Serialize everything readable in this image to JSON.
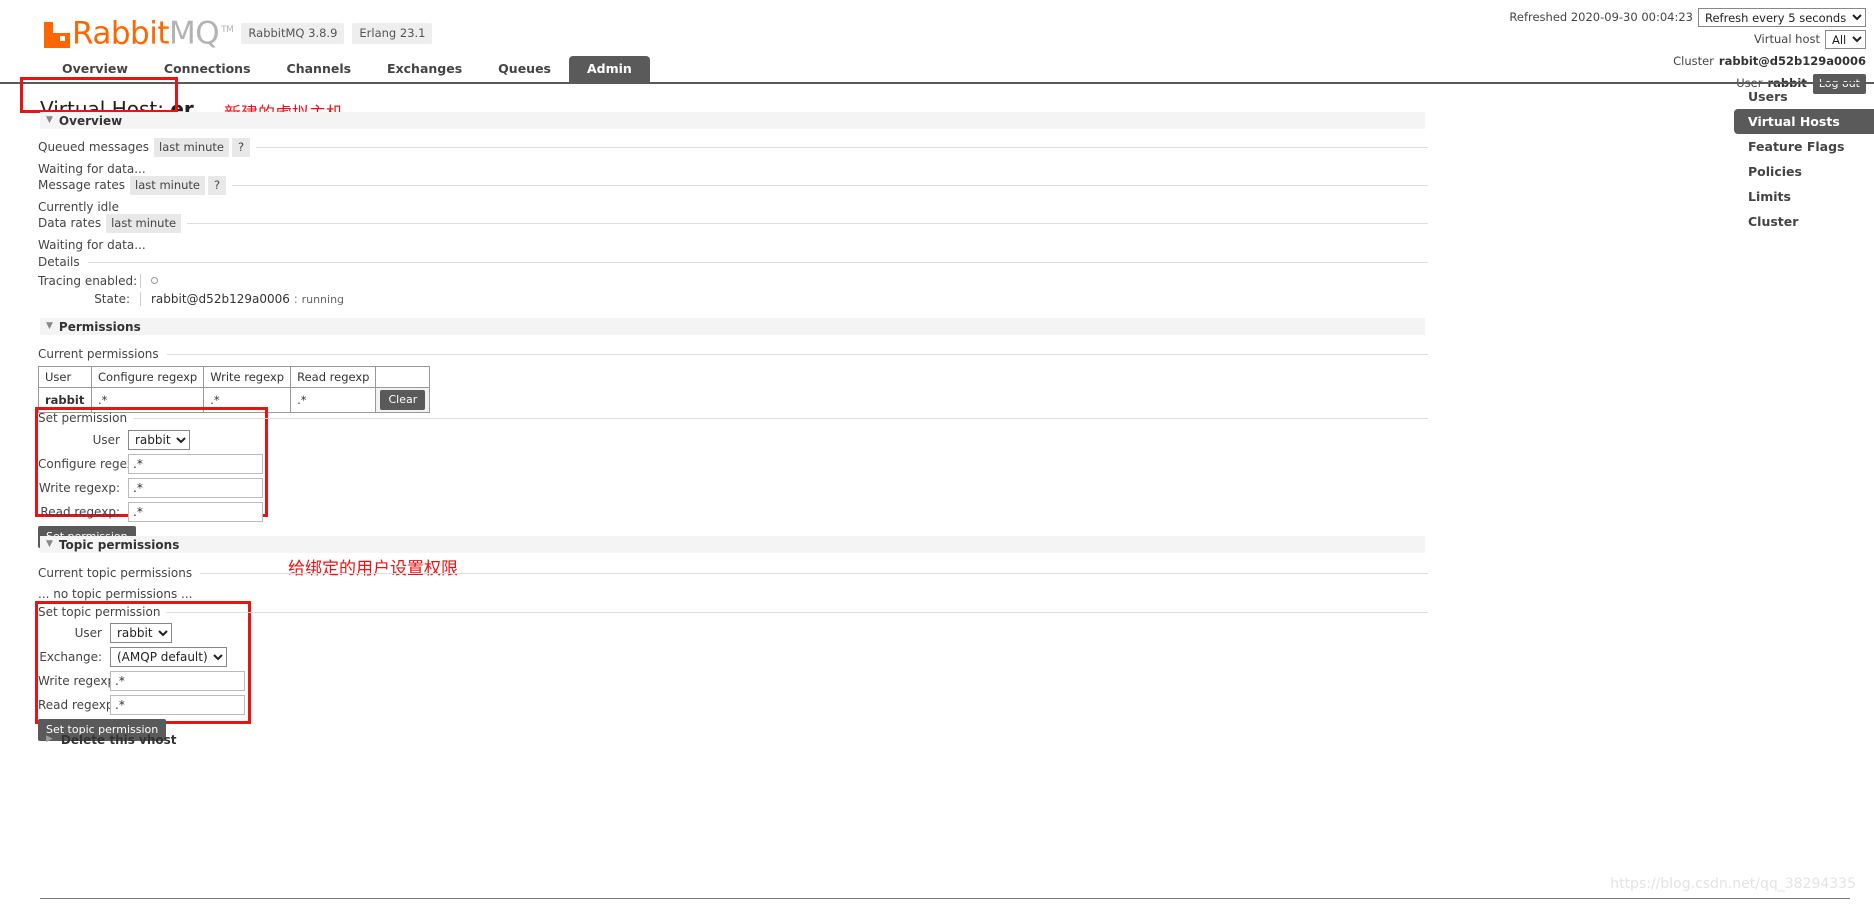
{
  "header": {
    "logo": {
      "rabbit": "Rabbit",
      "mq": "MQ",
      "tm": "TM"
    },
    "version_pills": [
      "RabbitMQ 3.8.9",
      "Erlang 23.1"
    ],
    "refreshed_label": "Refreshed 2020-09-30 00:04:23",
    "refresh_select": "Refresh every 5 seconds",
    "vhost_label": "Virtual host",
    "vhost_select": "All",
    "cluster_label": "Cluster",
    "cluster_value": "rabbit@d52b129a0006",
    "user_label": "User",
    "user_value": "rabbit",
    "logout_label": "Log out"
  },
  "nav": {
    "tabs": [
      {
        "label": "Overview",
        "active": false
      },
      {
        "label": "Connections",
        "active": false
      },
      {
        "label": "Channels",
        "active": false
      },
      {
        "label": "Exchanges",
        "active": false
      },
      {
        "label": "Queues",
        "active": false
      },
      {
        "label": "Admin",
        "active": true
      }
    ]
  },
  "page": {
    "title_prefix": "Virtual Host: ",
    "title_vhost": "er",
    "annotation_title": "新建的虚拟主机",
    "annotation_permissions": "给绑定的用户设置权限"
  },
  "overview": {
    "section_label": "Overview",
    "queued_messages_label": "Queued messages",
    "queued_messages_pill": "last minute",
    "help_pill": "?",
    "queued_messages_value": "Waiting for data...",
    "message_rates_label": "Message rates",
    "message_rates_pill": "last minute",
    "message_rates_value": "Currently idle",
    "data_rates_label": "Data rates",
    "data_rates_pill": "last minute",
    "data_rates_value": "Waiting for data...",
    "details_label": "Details",
    "tracing_key": "Tracing enabled:",
    "tracing_value": "",
    "state_key": "State:",
    "state_node": "rabbit@d52b129a0006",
    "state_sep": ":",
    "state_value": "running"
  },
  "permissions": {
    "section_label": "Permissions",
    "current_label": "Current permissions",
    "table": {
      "headers": [
        "User",
        "Configure regexp",
        "Write regexp",
        "Read regexp",
        ""
      ],
      "rows": [
        {
          "user": "rabbit",
          "configure": ".*",
          "write": ".*",
          "read": ".*",
          "action": "Clear"
        }
      ]
    },
    "form": {
      "caption": "Set permission",
      "user_label": "User",
      "user_value": "rabbit",
      "configure_label": "Configure regexp:",
      "configure_value": ".*",
      "write_label": "Write regexp:",
      "write_value": ".*",
      "read_label": "Read regexp:",
      "read_value": ".*",
      "submit_label": "Set permission"
    }
  },
  "topic_permissions": {
    "section_label": "Topic permissions",
    "current_label": "Current topic permissions",
    "empty_text": "... no topic permissions ...",
    "form": {
      "caption": "Set topic permission",
      "user_label": "User",
      "user_value": "rabbit",
      "exchange_label": "Exchange:",
      "exchange_value": "(AMQP default)",
      "write_label": "Write regexp:",
      "write_value": ".*",
      "read_label": "Read regexp:",
      "read_value": ".*",
      "submit_label": "Set topic permission"
    }
  },
  "delete": {
    "label": "Delete this vhost"
  },
  "sidebar": {
    "items": [
      {
        "label": "Users",
        "active": false
      },
      {
        "label": "Virtual Hosts",
        "active": true
      },
      {
        "label": "Feature Flags",
        "active": false
      },
      {
        "label": "Policies",
        "active": false
      },
      {
        "label": "Limits",
        "active": false
      },
      {
        "label": "Cluster",
        "active": false
      }
    ]
  },
  "watermark": "https://blog.csdn.net/qq_38294335"
}
